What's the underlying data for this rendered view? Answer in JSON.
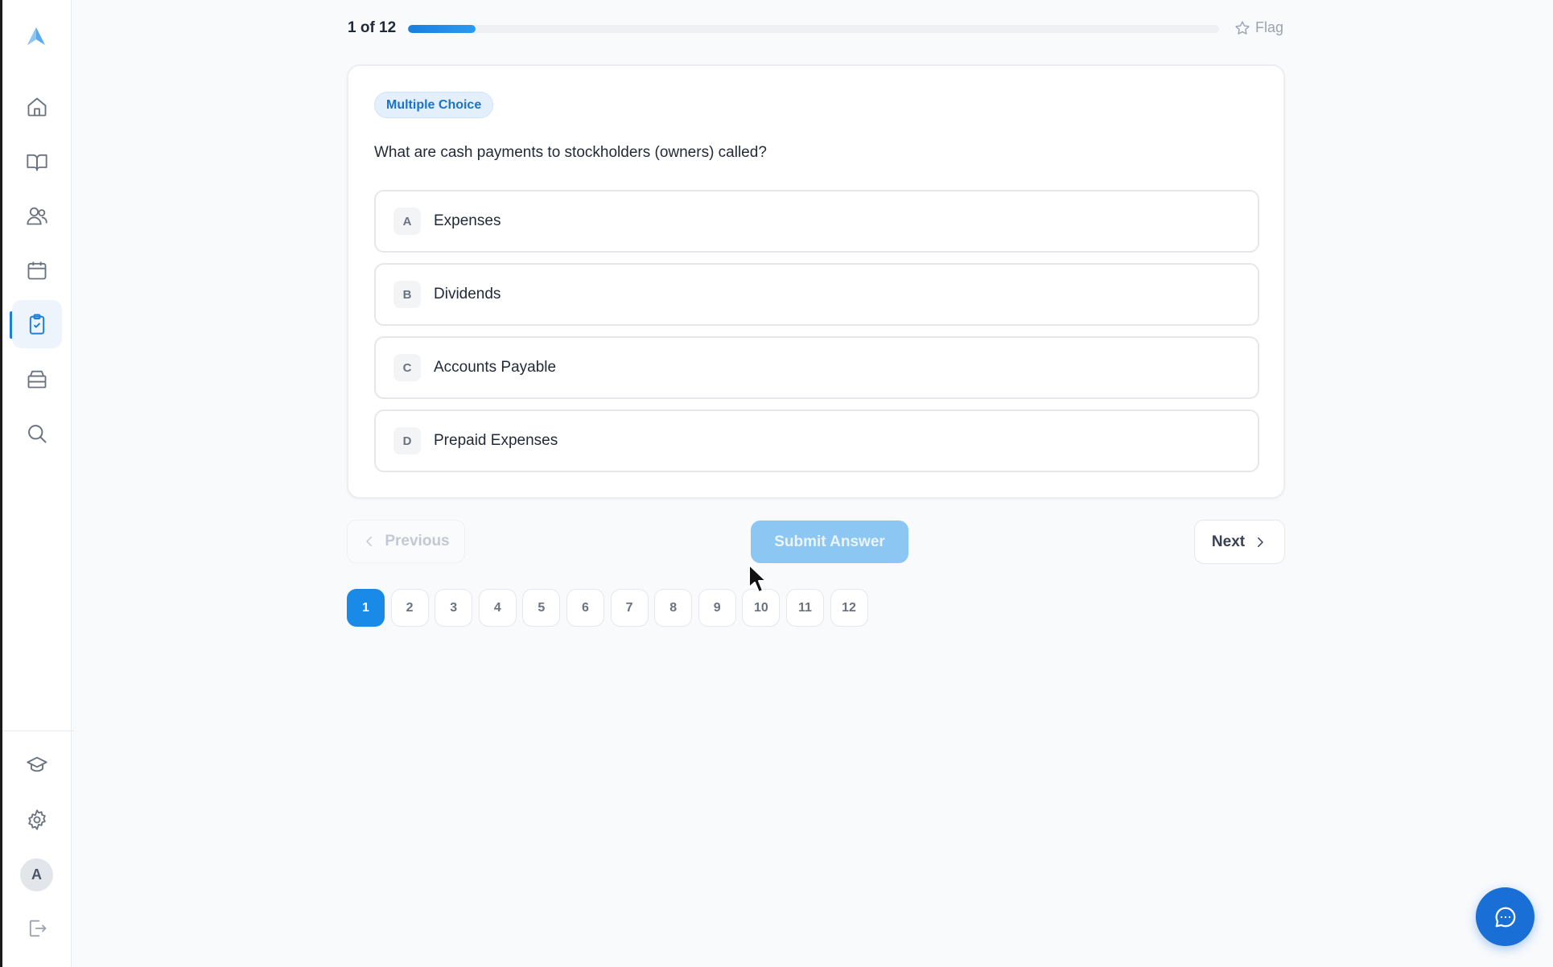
{
  "sidebar": {
    "logo_icon": "logo-arrow-icon",
    "items": [
      {
        "name": "home",
        "icon": "home-icon"
      },
      {
        "name": "library",
        "icon": "book-open-icon"
      },
      {
        "name": "community",
        "icon": "users-icon"
      },
      {
        "name": "calendar",
        "icon": "calendar-icon"
      },
      {
        "name": "quizzes",
        "icon": "clipboard-check-icon",
        "active": true
      },
      {
        "name": "archive",
        "icon": "archive-icon"
      },
      {
        "name": "search",
        "icon": "search-icon"
      }
    ],
    "bottom_items": [
      {
        "name": "courses",
        "icon": "graduation-cap-icon"
      },
      {
        "name": "settings",
        "icon": "gear-icon"
      },
      {
        "name": "logout",
        "icon": "logout-icon"
      }
    ],
    "avatar_initial": "A"
  },
  "progress": {
    "label": "1 of 12",
    "value": 0.083,
    "flag_label": "Flag"
  },
  "question": {
    "badge": "Multiple Choice",
    "text": "What are cash payments to stockholders (owners) called?",
    "options": [
      {
        "letter": "A",
        "text": "Expenses"
      },
      {
        "letter": "B",
        "text": "Dividends"
      },
      {
        "letter": "C",
        "text": "Accounts Payable"
      },
      {
        "letter": "D",
        "text": "Prepaid Expenses"
      }
    ]
  },
  "navigation": {
    "previous_label": "Previous",
    "submit_label": "Submit Answer",
    "next_label": "Next"
  },
  "pager": {
    "current": 1,
    "pages": [
      "1",
      "2",
      "3",
      "4",
      "5",
      "6",
      "7",
      "8",
      "9",
      "10",
      "11",
      "12"
    ]
  },
  "colors": {
    "accent": "#1a8ae8",
    "submit_disabled": "#8cc6f2",
    "chat_fab": "#1a6fd6"
  },
  "chat": {
    "icon": "chat-bubble-icon"
  }
}
